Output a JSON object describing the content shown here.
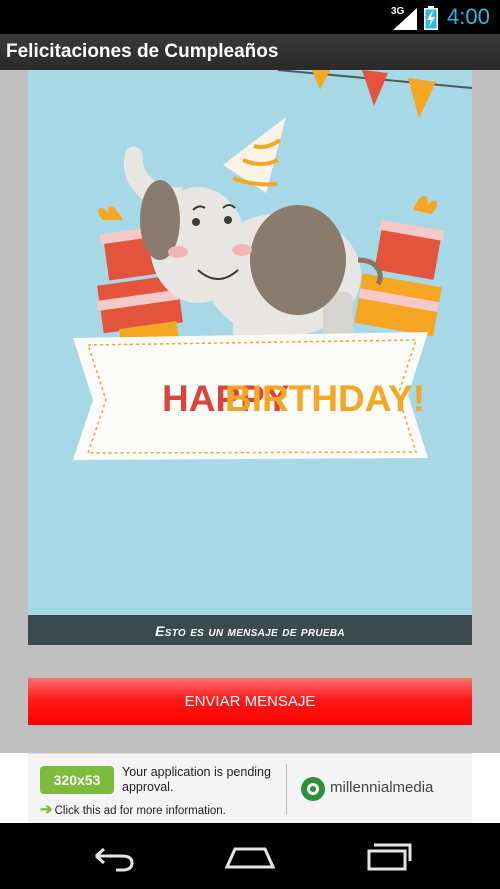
{
  "status_bar": {
    "network": "3G",
    "time": "4:00"
  },
  "app": {
    "title": "Felicitaciones de Cumpleaños"
  },
  "card": {
    "banner_text_1": "HAPPY",
    "banner_text_2": "BIRTHDAY!",
    "message": "Esto es un mensaje de prueba"
  },
  "actions": {
    "send_label": "ENVIAR MENSAJE"
  },
  "ad": {
    "size_label": "320x53",
    "pending_text": "Your application is pending approval.",
    "click_text": "Click this ad for more information.",
    "brand": "millennialmedia"
  },
  "colors": {
    "card_background": "#a6d8e6",
    "happy_red": "#d9453a",
    "birthday_orange": "#f5a623",
    "send_button": "#ff0000",
    "accent_blue": "#33b5e5"
  },
  "icons": {
    "navbar": [
      "back-icon",
      "home-icon",
      "recent-apps-icon"
    ],
    "status": [
      "signal-icon",
      "battery-icon"
    ]
  }
}
